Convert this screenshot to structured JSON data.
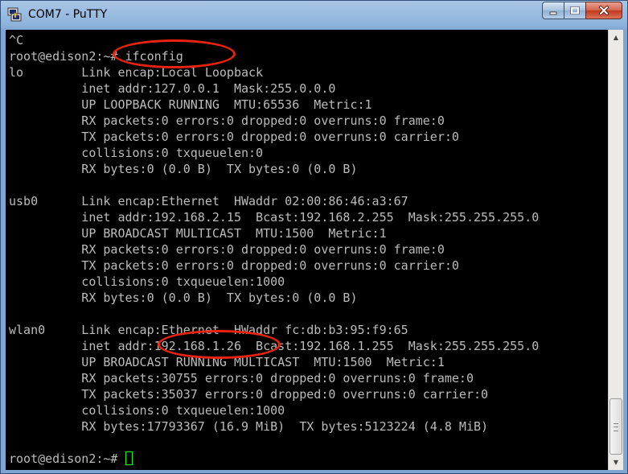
{
  "window": {
    "title": "COM7 - PuTTY",
    "controls": {
      "minimize": "minimize",
      "maximize": "maximize",
      "close": "close"
    },
    "accent_color": "#e8230f",
    "cursor_color": "#00ff00"
  },
  "terminal": {
    "lines": [
      "^C",
      "root@edison2:~# ifconfig",
      "lo        Link encap:Local Loopback",
      "          inet addr:127.0.0.1  Mask:255.0.0.0",
      "          UP LOOPBACK RUNNING  MTU:65536  Metric:1",
      "          RX packets:0 errors:0 dropped:0 overruns:0 frame:0",
      "          TX packets:0 errors:0 dropped:0 overruns:0 carrier:0",
      "          collisions:0 txqueuelen:0",
      "          RX bytes:0 (0.0 B)  TX bytes:0 (0.0 B)",
      "",
      "usb0      Link encap:Ethernet  HWaddr 02:00:86:46:a3:67",
      "          inet addr:192.168.2.15  Bcast:192.168.2.255  Mask:255.255.255.0",
      "          UP BROADCAST MULTICAST  MTU:1500  Metric:1",
      "          RX packets:0 errors:0 dropped:0 overruns:0 frame:0",
      "          TX packets:0 errors:0 dropped:0 overruns:0 carrier:0",
      "          collisions:0 txqueuelen:1000",
      "          RX bytes:0 (0.0 B)  TX bytes:0 (0.0 B)",
      "",
      "wlan0     Link encap:Ethernet  HWaddr fc:db:b3:95:f9:65",
      "          inet addr:192.168.1.26  Bcast:192.168.1.255  Mask:255.255.255.0",
      "          UP BROADCAST RUNNING MULTICAST  MTU:1500  Metric:1",
      "          RX packets:30755 errors:0 dropped:0 overruns:0 frame:0",
      "          TX packets:35037 errors:0 dropped:0 overruns:0 carrier:0",
      "          collisions:0 txqueuelen:1000",
      "          RX bytes:17793367 (16.9 MiB)  TX bytes:5123224 (4.8 MiB)",
      ""
    ],
    "prompt": "root@edison2:~# "
  }
}
